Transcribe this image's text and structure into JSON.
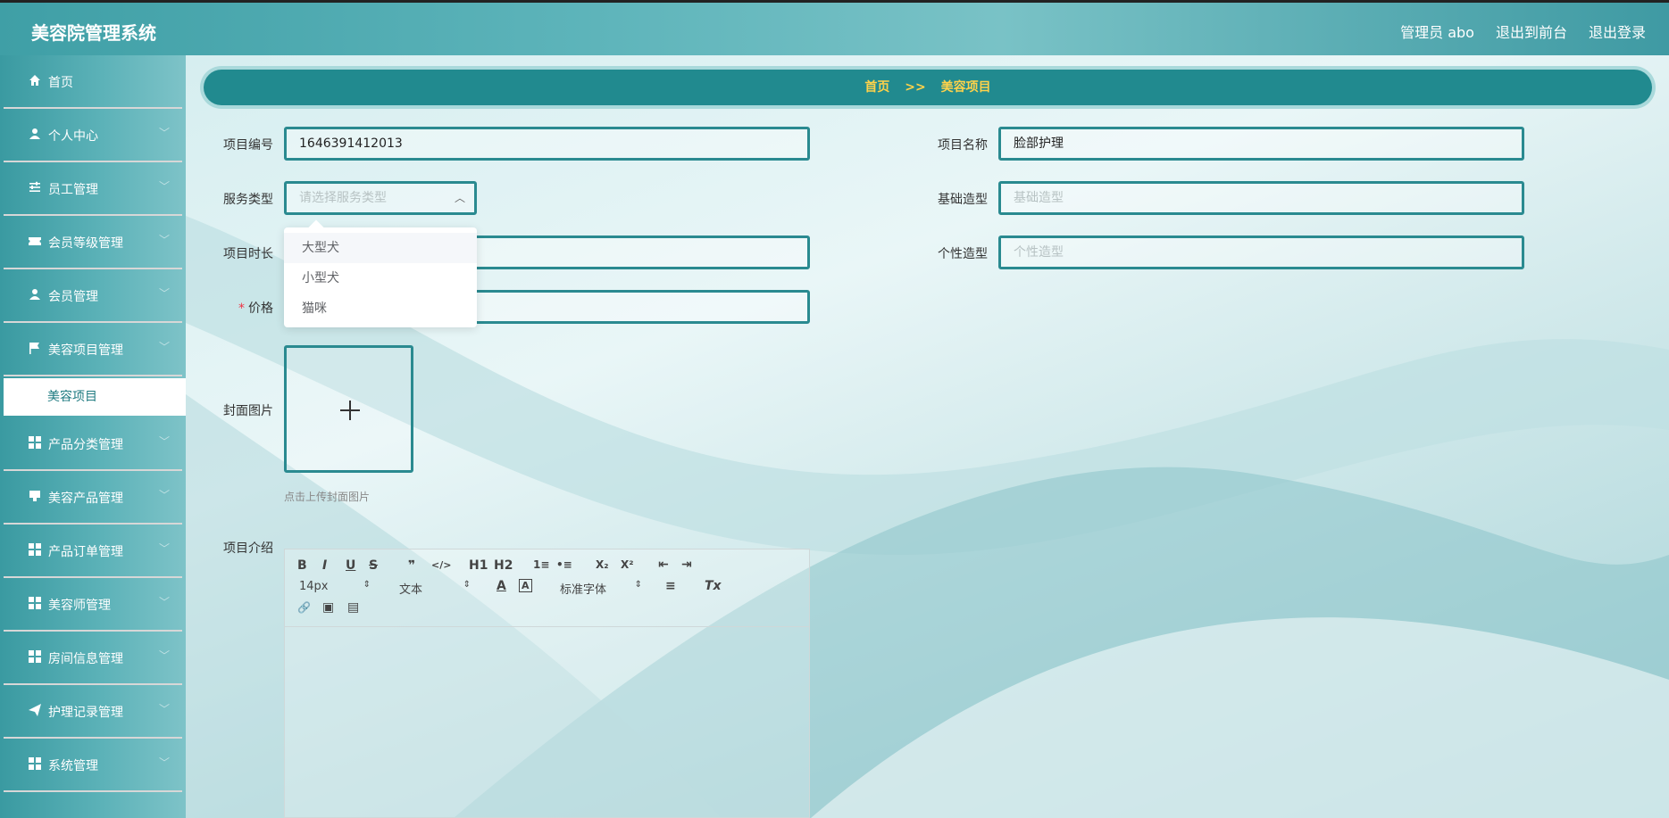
{
  "app": {
    "title": "美容院管理系统"
  },
  "top_links": {
    "admin": "管理员 abo",
    "front": "退出到前台",
    "logout": "退出登录"
  },
  "sidebar": {
    "items": [
      {
        "label": "首页",
        "icon": "home-icon"
      },
      {
        "label": "个人中心",
        "icon": "user-icon"
      },
      {
        "label": "员工管理",
        "icon": "sliders-icon"
      },
      {
        "label": "会员等级管理",
        "icon": "ticket-icon"
      },
      {
        "label": "会员管理",
        "icon": "user-icon"
      },
      {
        "label": "美容项目管理",
        "icon": "flag-icon"
      }
    ],
    "active_sub": "美容项目",
    "items_after": [
      {
        "label": "产品分类管理",
        "icon": "grid-icon"
      },
      {
        "label": "美容产品管理",
        "icon": "box-icon"
      },
      {
        "label": "产品订单管理",
        "icon": "grid-icon"
      },
      {
        "label": "美容师管理",
        "icon": "grid-icon"
      },
      {
        "label": "房间信息管理",
        "icon": "grid-icon"
      },
      {
        "label": "护理记录管理",
        "icon": "send-icon"
      },
      {
        "label": "系统管理",
        "icon": "grid-icon"
      }
    ]
  },
  "breadcrumb": {
    "home": "首页",
    "sep": ">>",
    "current": "美容项目"
  },
  "form": {
    "code_label": "项目编号",
    "code_value": "1646391412013",
    "name_label": "项目名称",
    "name_value": "脸部护理",
    "service_label": "服务类型",
    "service_placeholder": "请选择服务类型",
    "base_label": "基础造型",
    "base_placeholder": "基础造型",
    "duration_label": "项目时长",
    "style_label": "个性造型",
    "style_placeholder": "个性造型",
    "price_label": "价格",
    "price_required": "*",
    "cover_label": "封面图片",
    "cover_tip": "点击上传封面图片",
    "intro_label": "项目介绍"
  },
  "dropdown": {
    "options": [
      "大型犬",
      "小型犬",
      "猫咪"
    ],
    "hovered_index": 0
  },
  "editor": {
    "bold": "B",
    "italic": "I",
    "underline": "U",
    "strike": "S",
    "quote": "❞",
    "code": "</>",
    "h1": "H1",
    "h2": "H2",
    "ol": "1≡",
    "ul": "•≡",
    "sub": "X₂",
    "sup": "X²",
    "outdent": "⇤",
    "indent": "⇥",
    "size": "14px",
    "format": "文本",
    "font": "标准字体",
    "align": "≡",
    "clear": "Tx",
    "link": "🔗",
    "image": "▣",
    "video": "▤"
  }
}
